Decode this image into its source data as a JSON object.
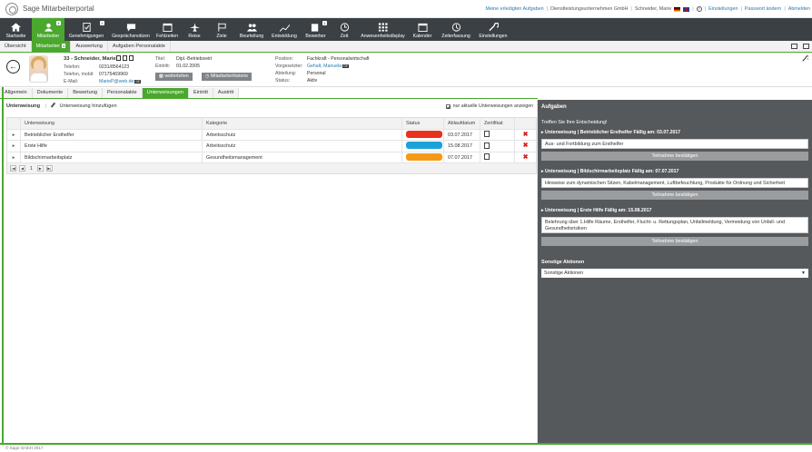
{
  "app": {
    "title": "Sage Mitarbeiterportal",
    "copyright": "© Sage GmbH 2017"
  },
  "toplinks": {
    "tasks": "Meine erledigten Aufgaben",
    "company": "Dienstleistungsunternehmen GmbH",
    "user": "Schneider, Marie",
    "settings": "Einstellungen",
    "password": "Passwort ändern",
    "logout": "Abmelden"
  },
  "nav": {
    "items": [
      {
        "label": "Startseite",
        "icon": "home-icon"
      },
      {
        "label": "Mitarbeiter",
        "icon": "employee-icon",
        "badge": "4"
      },
      {
        "label": "Genehmigungen",
        "icon": "approvals-icon",
        "badge": "1"
      },
      {
        "label": "Gesprächsnotizen",
        "icon": "notes-icon"
      },
      {
        "label": "Fehlzeiten",
        "icon": "calendar-icon"
      },
      {
        "label": "Reise",
        "icon": "plane-icon"
      },
      {
        "label": "Ziele",
        "icon": "flag-icon"
      },
      {
        "label": "Beurteilung",
        "icon": "people-icon"
      },
      {
        "label": "Entwicklung",
        "icon": "chart-icon"
      },
      {
        "label": "Bewerber",
        "icon": "applicant-icon",
        "badge": "1"
      },
      {
        "label": "Zeit",
        "icon": "clock-icon"
      },
      {
        "label": "Anwesenheitsdisplay",
        "icon": "grid-icon"
      },
      {
        "label": "Kalender",
        "icon": "calendar-icon"
      },
      {
        "label": "Zeiterfassung",
        "icon": "time-tracking-icon"
      },
      {
        "label": "Einstellungen",
        "icon": "wrench-icon"
      }
    ]
  },
  "subtabs": {
    "overview": "Übersicht",
    "employee": "Mitarbeiter",
    "employee_badge": "4",
    "evaluation": "Auswertung",
    "hr_tasks": "Aufgaben Personalakte"
  },
  "employee": {
    "name": "33 - Schneider, Marie",
    "phone_label": "Telefon:",
    "phone": "0231/8564123",
    "mobile_label": "Telefon, mobil:",
    "mobile": "07175469969",
    "email_label": "E-Mail:",
    "email": "MarieP@web.de",
    "email_badge": "DE",
    "title_label": "Titel:",
    "title": "Dipl.-Betriebswirt",
    "entry_label": "Eintritt:",
    "entry": "01.02.2005",
    "position_label": "Position:",
    "position": "Fachkraft - Personalwirtschaft",
    "supervisor_label": "Vorgesetzter:",
    "supervisor": "Gehalt, Manuela",
    "supervisor_badge": "DE",
    "department_label": "Abteilung:",
    "department": "Personal",
    "status_label": "Status:",
    "status": "Aktiv",
    "forward_button": "weiterleiten",
    "history_button": "Mitarbeiterhistorie"
  },
  "sectabs": [
    "Allgemein",
    "Dokumente",
    "Bewertung",
    "Personalakte",
    "Unterweisungen",
    "Eintritt",
    "Austritt"
  ],
  "instructions": {
    "title": "Unterweisung",
    "add": "Unterweisung hinzufügen",
    "only_current": "nur aktuelle Unterweisungen anzeigen",
    "headers": {
      "name": "Unterweisung",
      "category": "Kategorie",
      "status": "Status",
      "expiry": "Ablaufdatum",
      "cert": "Zertifikat"
    },
    "rows": [
      {
        "name": "Betrieblicher Ersthelfer",
        "category": "Arbeitsschutz",
        "status_color": "#e8321e",
        "expiry": "03.07.2017"
      },
      {
        "name": "Erste Hilfe",
        "category": "Arbeitsschutz",
        "status_color": "#1aa3d9",
        "expiry": "15.08.2017"
      },
      {
        "name": "Bildschirmarbeitsplatz",
        "category": "Gesundheitsmanagement",
        "status_color": "#f59a16",
        "expiry": "07.07.2017"
      }
    ],
    "page": "1"
  },
  "tasks": {
    "title": "Aufgaben",
    "subtitle": "Treffen Sie Ihre Entscheidung!",
    "items": [
      {
        "heading": "Unterweisung | Betrieblicher Ersthelfer Fällig am: 03.07.2017",
        "text": "Aus- und Fortbildung zum Ersthelfer",
        "button": "Teilnahme bestätigen"
      },
      {
        "heading": "Unterweisung | Bildschirmarbeitsplatz Fällig am: 07.07.2017",
        "text": "Hinweise zum dynamischen Sitzen, Kabelmanagement, Luftbefeuchtung, Produkte für Ordnung und Sicherheit",
        "button": "Teilnahme bestätigen"
      },
      {
        "heading": "Unterweisung | Erste Hilfe Fällig am: 15.08.2017",
        "text": "Belehrung über 1.Hilfe Räume, Ersthelfer, Flucht- u. Rettungsplan, Unfallmeldung, Vermeidung von Unfall- und Gesundheitsrisiken",
        "button": "Teilnahme bestätigen"
      }
    ],
    "other_title": "Sonstige Aktionen",
    "other_select": "Sonstige Aktionen"
  }
}
